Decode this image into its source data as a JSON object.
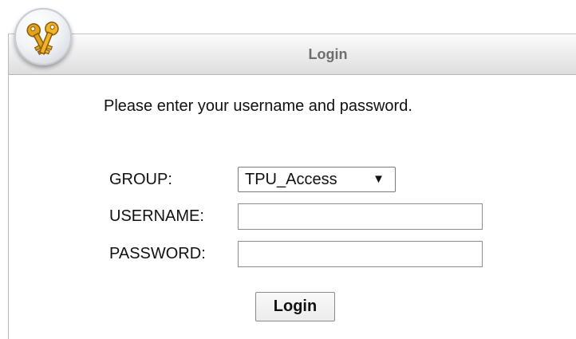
{
  "header": {
    "title": "Login",
    "logo_icon": "keys-icon"
  },
  "intro_text": "Please enter your username and password.",
  "form": {
    "group": {
      "label": "GROUP:",
      "selected": "TPU_Access",
      "arrow": "▼"
    },
    "username": {
      "label": "USERNAME:",
      "value": ""
    },
    "password": {
      "label": "PASSWORD:",
      "value": ""
    },
    "submit_label": "Login"
  },
  "colors": {
    "header_title": "#6e6e6e",
    "text": "#111111",
    "border": "#b9b9b9",
    "key_gold": "#e3a21a"
  }
}
